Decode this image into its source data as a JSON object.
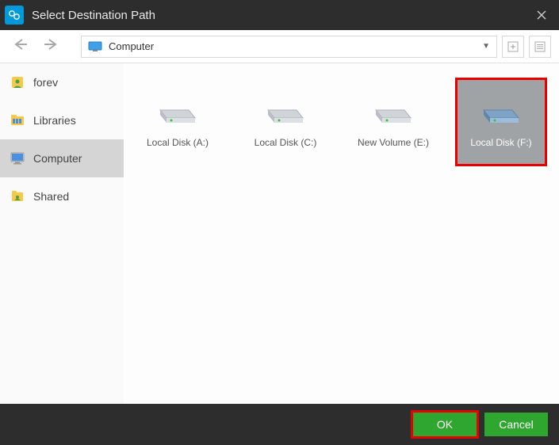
{
  "title": "Select Destination Path",
  "path": {
    "label": "Computer"
  },
  "sidebar": {
    "items": [
      {
        "label": "forev"
      },
      {
        "label": "Libraries"
      },
      {
        "label": "Computer"
      },
      {
        "label": "Shared"
      }
    ]
  },
  "drives": [
    {
      "label": "Local Disk (A:)"
    },
    {
      "label": "Local Disk (C:)"
    },
    {
      "label": "New Volume (E:)"
    },
    {
      "label": "Local Disk (F:)"
    }
  ],
  "buttons": {
    "ok": "OK",
    "cancel": "Cancel"
  }
}
